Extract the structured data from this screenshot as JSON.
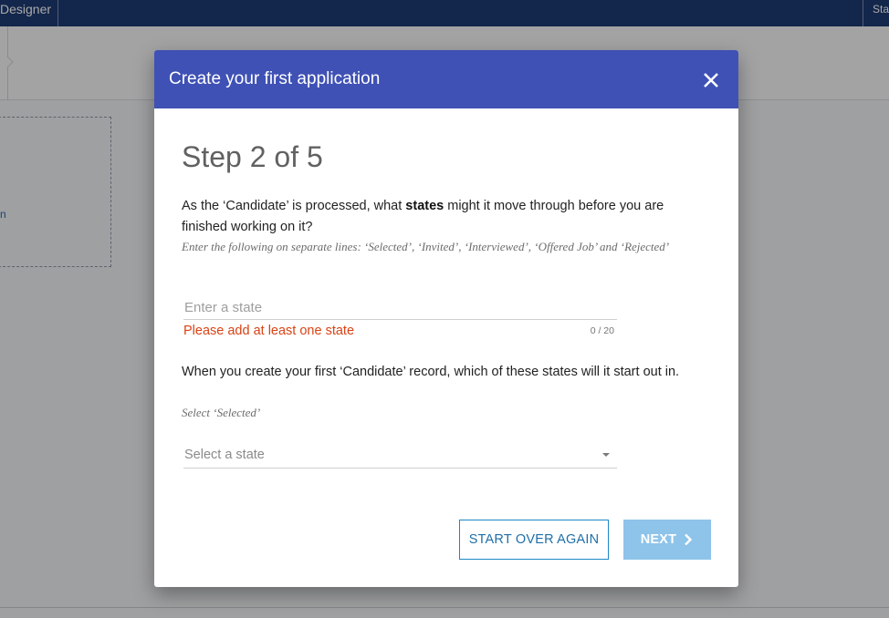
{
  "app": {
    "left_tab": "Designer",
    "right_tab": "Sta",
    "sidebar_link": "n"
  },
  "modal": {
    "title": "Create your first application",
    "step_title": "Step 2 of 5",
    "question1": {
      "before": "As the ‘Candidate’ is processed, what ",
      "bold": "states",
      "after": " might it move through before you are finished working on it?"
    },
    "hint1": "Enter the following on separate lines: ‘Selected’, ‘Invited’, ‘Interviewed’, ‘Offered Job’ and ‘Rejected’",
    "state_input": {
      "placeholder": "Enter a state",
      "value": ""
    },
    "error": "Please add at least one state",
    "counter": "0 / 20",
    "question2": "When you create your first ‘Candidate’ record, which of these states will it start out in.",
    "hint2": "Select ‘Selected’",
    "select": {
      "value": "Select a state"
    },
    "buttons": {
      "start_over": "START OVER AGAIN",
      "next": "NEXT"
    }
  },
  "colors": {
    "header": "#3f51b5",
    "error": "#d84315",
    "primary_button": "#8ec3ea",
    "outline_button": "#1e88c7"
  }
}
